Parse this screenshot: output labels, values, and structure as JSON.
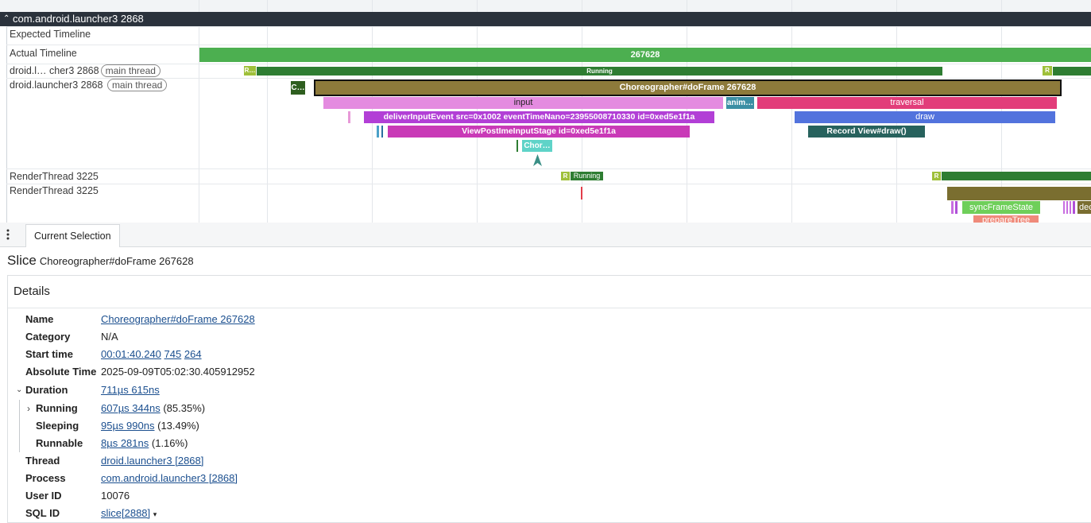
{
  "process": {
    "title": "com.android.launcher3 2868"
  },
  "tracks": {
    "expected": "Expected Timeline",
    "actual": "Actual Timeline",
    "thread_short": "droid.l… cher3 2868",
    "thread_full": "droid.launcher3 2868",
    "main_thread_pill": "main thread",
    "render1": "RenderThread 3225",
    "render2": "RenderThread 3225"
  },
  "slices": {
    "frame": "267628",
    "state_r": "R…",
    "running": "Running",
    "r": "R",
    "c_short": "C…",
    "doframe": "Choreographer#doFrame 267628",
    "input": "input",
    "anim": "anim…",
    "traversal": "traversal",
    "deliver": "deliverInputEvent src=0x1002 eventTimeNano=23955008710330 id=0xed5e1f1a",
    "draw": "draw",
    "viewpost": "ViewPostImeInputStage id=0xed5e1f1a",
    "record": "Record View#draw()",
    "chor": "Chor…",
    "rt_r": "R",
    "rt_running": "Running",
    "rt_r2": "R",
    "sync": "syncFrameState",
    "prepare": "prepareTree",
    "dec": "dec"
  },
  "panel": {
    "tab": "Current Selection",
    "slice_label": "Slice",
    "slice_name": "Choreographer#doFrame 267628",
    "details_title": "Details"
  },
  "details": {
    "name_k": "Name",
    "name_v": "Choreographer#doFrame 267628",
    "category_k": "Category",
    "category_v": "N/A",
    "start_k": "Start time",
    "start_a": "00:01:40.240",
    "start_b": "745",
    "start_c": "264",
    "abs_k": "Absolute Time",
    "abs_v": "2025-09-09T05:02:30.405912952",
    "dur_k": "Duration",
    "dur_v": "711µs 615ns",
    "running_k": "Running",
    "running_v": "607µs 344ns",
    "running_p": "(85.35%)",
    "sleeping_k": "Sleeping",
    "sleeping_v": "95µs 990ns",
    "sleeping_p": "(13.49%)",
    "runnable_k": "Runnable",
    "runnable_v": "8µs 281ns",
    "runnable_p": "(1.16%)",
    "thread_k": "Thread",
    "thread_v": "droid.launcher3 [2868]",
    "process_k": "Process",
    "process_v": "com.android.launcher3 [2868]",
    "uid_k": "User ID",
    "uid_v": "10076",
    "sql_k": "SQL ID",
    "sql_v": "slice[2888]"
  },
  "colors": {
    "header_bg": "#2b323c",
    "actual_green": "#4caf50",
    "running_green": "#2e7d32",
    "doframe_olive": "#8d7a3b",
    "input_pink": "#e48be0",
    "traversal_pink": "#e23d7a",
    "deliver_purple": "#b23fd6",
    "draw_blue": "#5273dd",
    "record_teal": "#27625d",
    "link_blue": "#1b4f8f"
  }
}
